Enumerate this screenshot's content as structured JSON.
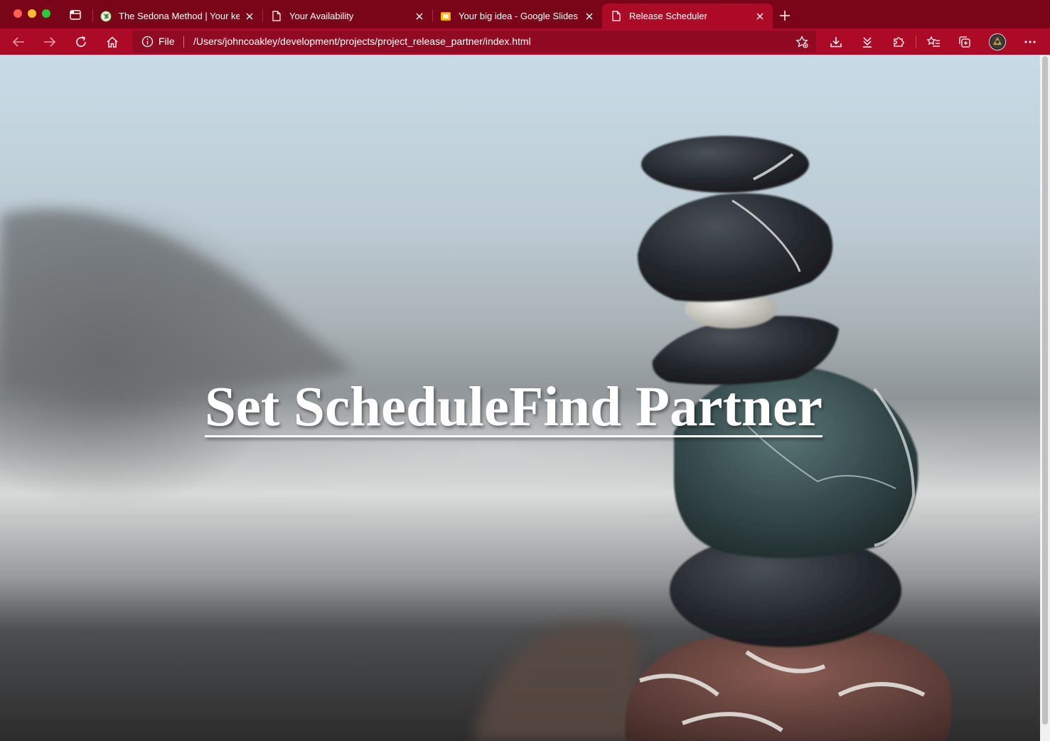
{
  "browser": {
    "tabs": [
      {
        "title": "The Sedona Method | Your key",
        "icon": "globe-favicon",
        "active": false
      },
      {
        "title": "Your Availability",
        "icon": "document-icon",
        "active": false
      },
      {
        "title": "Your big idea - Google Slides",
        "icon": "google-slides-icon",
        "active": false
      },
      {
        "title": "Release Scheduler",
        "icon": "document-icon",
        "active": true
      }
    ],
    "address_bar": {
      "scheme_label": "File",
      "url": "/Users/johncoakley/development/projects/project_release_partner/index.html"
    },
    "colors": {
      "titlebar": "#7a0418",
      "toolbar": "#ad0a28",
      "active_tab": "#ad0a28"
    }
  },
  "page": {
    "nav_links": [
      {
        "label": "Set Schedule"
      },
      {
        "label": "Find Partner"
      }
    ],
    "background": "stacked stones on beach photo"
  }
}
